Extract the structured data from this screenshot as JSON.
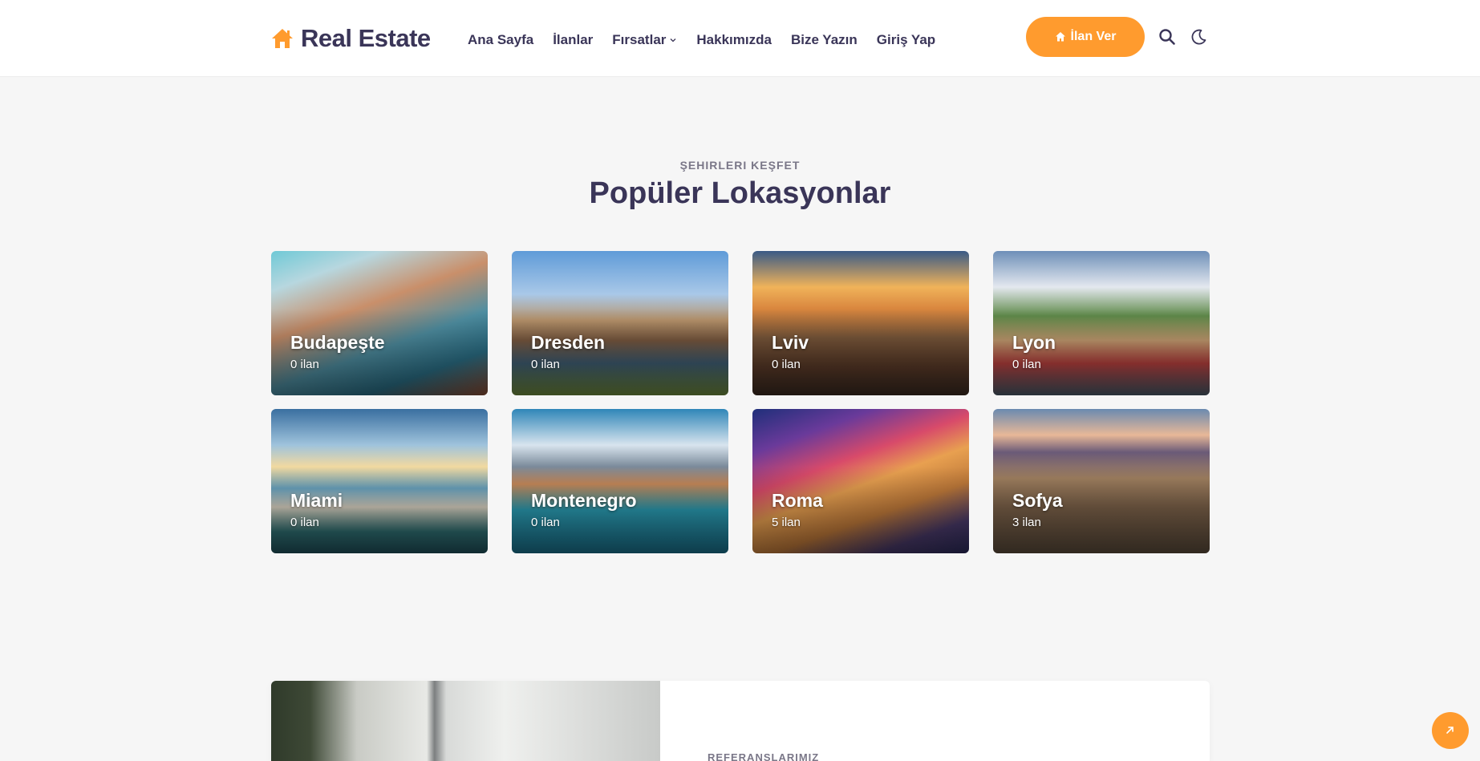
{
  "brand": {
    "name": "Real Estate",
    "accent": "#ff9b2e",
    "text_color": "#3a3558"
  },
  "nav": {
    "items": [
      {
        "label": "Ana Sayfa"
      },
      {
        "label": "İlanlar"
      },
      {
        "label": "Fırsatlar",
        "has_dropdown": true
      },
      {
        "label": "Hakkımızda"
      },
      {
        "label": "Bize Yazın"
      },
      {
        "label": "Giriş Yap"
      }
    ]
  },
  "header": {
    "cta_label": "İlan Ver",
    "cta_icon": "home-icon",
    "search_icon": "search-icon",
    "theme_icon": "moon-icon"
  },
  "section": {
    "eyebrow": "ŞEHIRLERI KEŞFET",
    "title": "Popüler Lokasyonlar"
  },
  "cities": [
    {
      "name": "Budapeşte",
      "count": "0 ilan"
    },
    {
      "name": "Dresden",
      "count": "0 ilan"
    },
    {
      "name": "Lviv",
      "count": "0 ilan"
    },
    {
      "name": "Lyon",
      "count": "0 ilan"
    },
    {
      "name": "Miami",
      "count": "0 ilan"
    },
    {
      "name": "Montenegro",
      "count": "0 ilan"
    },
    {
      "name": "Roma",
      "count": "5 ilan"
    },
    {
      "name": "Sofya",
      "count": "3 ilan"
    }
  ],
  "references": {
    "label": "REFERANSLARIMIZ"
  },
  "scroll_top_icon": "arrow-up-icon"
}
